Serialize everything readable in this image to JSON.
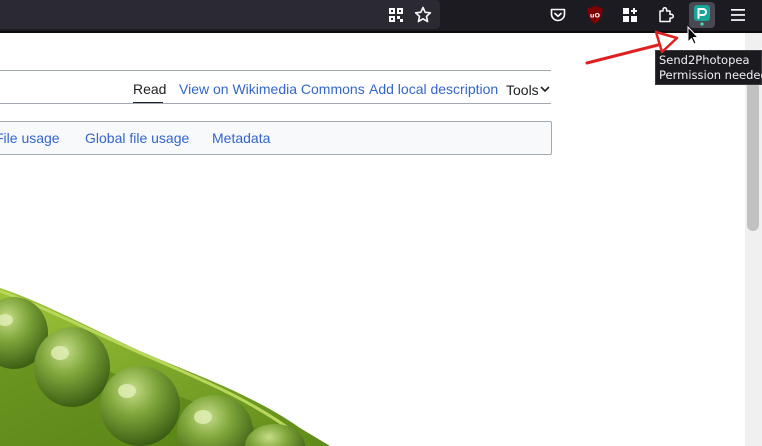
{
  "browser": {
    "toolbar_icons": [
      {
        "name": "qr-code-icon"
      },
      {
        "name": "bookmark-star-icon"
      },
      {
        "name": "pocket-icon"
      },
      {
        "name": "ublock-origin-icon",
        "badge": "uO",
        "color": "#800000"
      },
      {
        "name": "extension-grid-icon"
      },
      {
        "name": "extensions-puzzle-icon"
      },
      {
        "name": "send2photopea-icon",
        "color": "#18a497"
      },
      {
        "name": "hamburger-menu-icon"
      }
    ]
  },
  "tooltip": {
    "line1": "Send2Photopea",
    "line2": "Permission needed"
  },
  "page": {
    "view_tabs": {
      "read": "Read",
      "commons": "View on Wikimedia Commons",
      "local": "Add local description",
      "tools": "Tools"
    },
    "sub_tabs": {
      "file_usage": "File usage",
      "global_file_usage": "Global file usage",
      "metadata": "Metadata"
    },
    "image_subject": "green pea pod"
  },
  "colors": {
    "link": "#3366cc",
    "text": "#202122",
    "annotation_arrow": "#e02020"
  }
}
